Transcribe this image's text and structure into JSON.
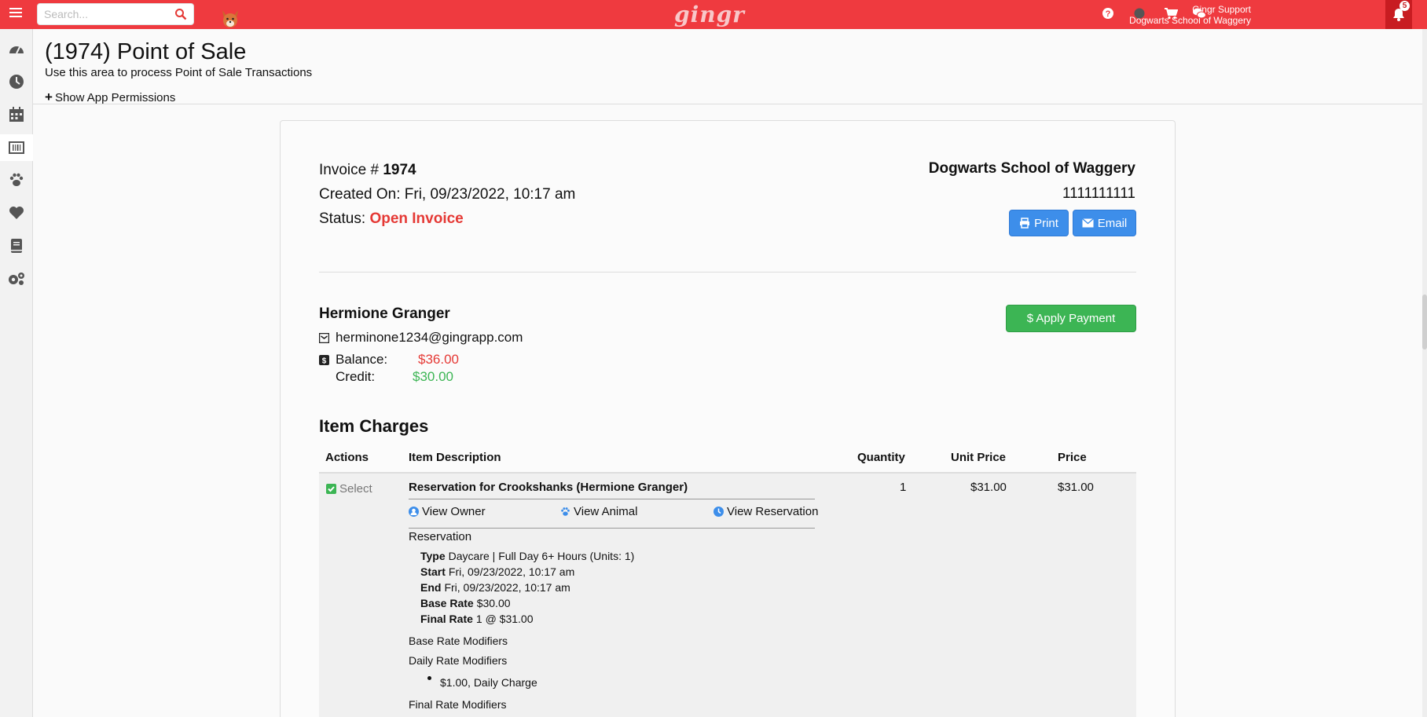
{
  "topbar": {
    "search_placeholder": "Search...",
    "logo_text": "gingr",
    "user_name": "Gingr Support",
    "business_name": "Dogwarts School of Waggery",
    "notification_count": "5",
    "brand_color": "#ef3a3f"
  },
  "sidebar": {
    "items": [
      "dashboard",
      "clock",
      "calendar",
      "barcode",
      "paw",
      "heart",
      "book",
      "cogs"
    ]
  },
  "header": {
    "title": "(1974) Point of Sale",
    "subtitle": "Use this area to process Point of Sale Transactions",
    "permissions_link": "Show App Permissions",
    "permissions_icon": "+"
  },
  "invoice": {
    "number_label": "Invoice #",
    "number": "1974",
    "created_label": "Created On:",
    "created_value": "Fri, 09/23/2022, 10:17 am",
    "status_label": "Status:",
    "status_value": "Open Invoice",
    "business_name": "Dogwarts School of Waggery",
    "business_phone": "1111111111",
    "print_label": "Print",
    "email_label": "Email"
  },
  "customer": {
    "name": "Hermione Granger",
    "email": "herminone1234@gingrapp.com",
    "balance_label": "Balance:",
    "balance_value": "$36.00",
    "credit_label": "Credit:",
    "credit_value": "$30.00",
    "apply_payment_label": "$ Apply Payment"
  },
  "charges": {
    "title": "Item Charges",
    "columns": {
      "actions": "Actions",
      "description": "Item Description",
      "quantity": "Quantity",
      "unit_price": "Unit Price",
      "price": "Price"
    },
    "row": {
      "select_label": "Select",
      "selected": true,
      "description": "Reservation for Crookshanks (Hermione Granger)",
      "quantity": "1",
      "unit_price": "$31.00",
      "price": "$31.00",
      "view_owner": "View Owner",
      "view_animal": "View Animal",
      "view_reservation": "View Reservation",
      "reservation_heading": "Reservation",
      "type_label": "Type",
      "type_value": "Daycare | Full Day 6+ Hours (Units: 1)",
      "start_label": "Start",
      "start_value": "Fri, 09/23/2022, 10:17 am",
      "end_label": "End",
      "end_value": "Fri, 09/23/2022, 10:17 am",
      "base_rate_label": "Base Rate",
      "base_rate_value": "$30.00",
      "final_rate_label": "Final Rate",
      "final_rate_value": "1 @ $31.00",
      "base_rate_modifiers": "Base Rate Modifiers",
      "daily_rate_modifiers": "Daily Rate Modifiers",
      "daily_charge": "$1.00, Daily Charge",
      "final_rate_modifiers": "Final Rate Modifiers"
    }
  }
}
